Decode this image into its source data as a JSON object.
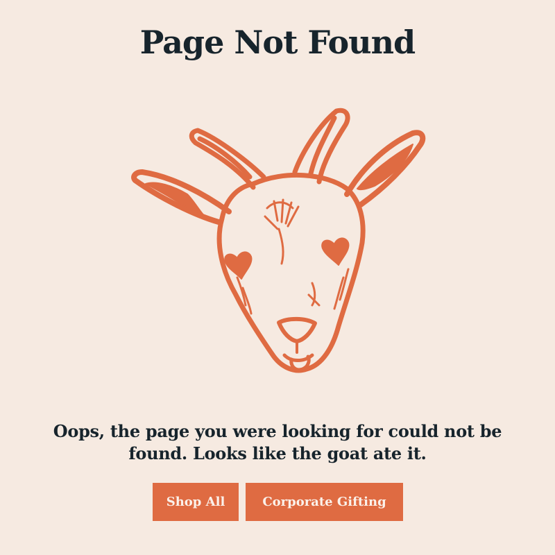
{
  "page": {
    "title": "Page Not Found",
    "message": "Oops, the page you were looking for could not be found. Looks like the goat ate it."
  },
  "illustration": {
    "name": "goat-head-illustration",
    "color": "#df6b42"
  },
  "buttons": {
    "shop_all": "Shop All",
    "corporate_gifting": "Corporate Gifting"
  },
  "colors": {
    "background": "#f6eae1",
    "text": "#17242c",
    "accent": "#df6b42",
    "button_text": "#fbf1ea"
  }
}
